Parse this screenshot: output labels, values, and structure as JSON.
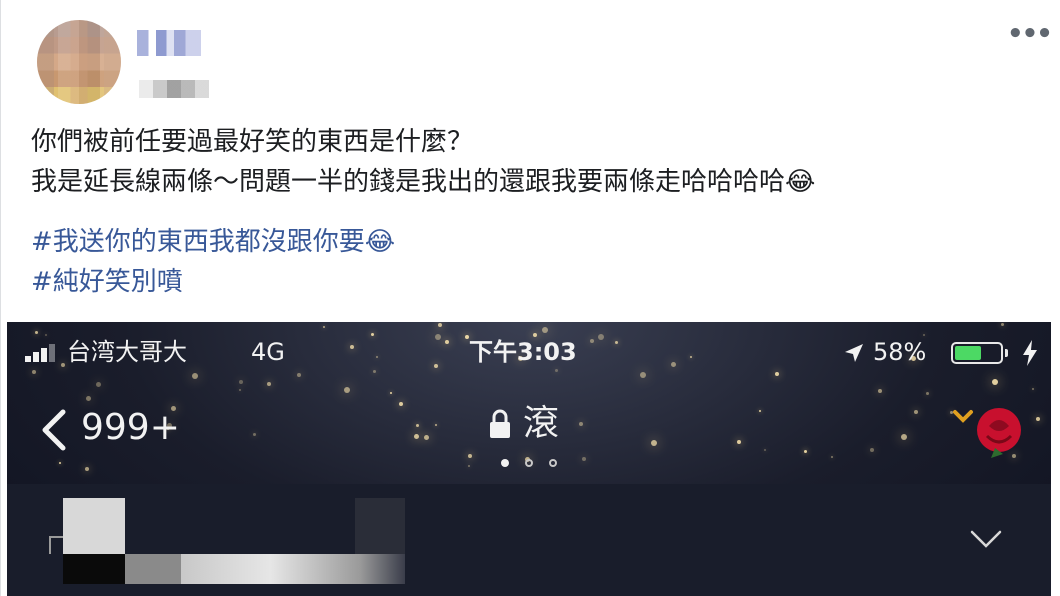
{
  "post": {
    "menu_label": "•••",
    "text_lines": [
      "你們被前任要過最好笑的東西是什麼？",
      "我是延長線兩條～問題一半的錢是我出的還跟我要兩條走哈哈哈哈"
    ],
    "emoji": "😂",
    "hashtags": [
      "#我送你的東西我都沒跟你要",
      "#純好笑別噴"
    ]
  },
  "phone": {
    "status_bar": {
      "carrier": "台湾大哥大",
      "network": "4G",
      "time": "下午3:03",
      "battery": "58%",
      "battery_level": 0.58
    },
    "nav": {
      "back_count": "999+",
      "title": "滾",
      "page_count": 3,
      "active_page": 1
    }
  },
  "colors": {
    "hashtag": "#385898",
    "text": "#1c1e21",
    "battery_fill": "#4cd964",
    "rose": "#c8102e",
    "chevron_gold": "#e0a020"
  },
  "icons": [
    "more-icon",
    "signal-icon",
    "location-icon",
    "battery-icon",
    "charging-icon",
    "back-chevron-icon",
    "lock-icon",
    "rose-icon",
    "expand-chevron-icon"
  ]
}
